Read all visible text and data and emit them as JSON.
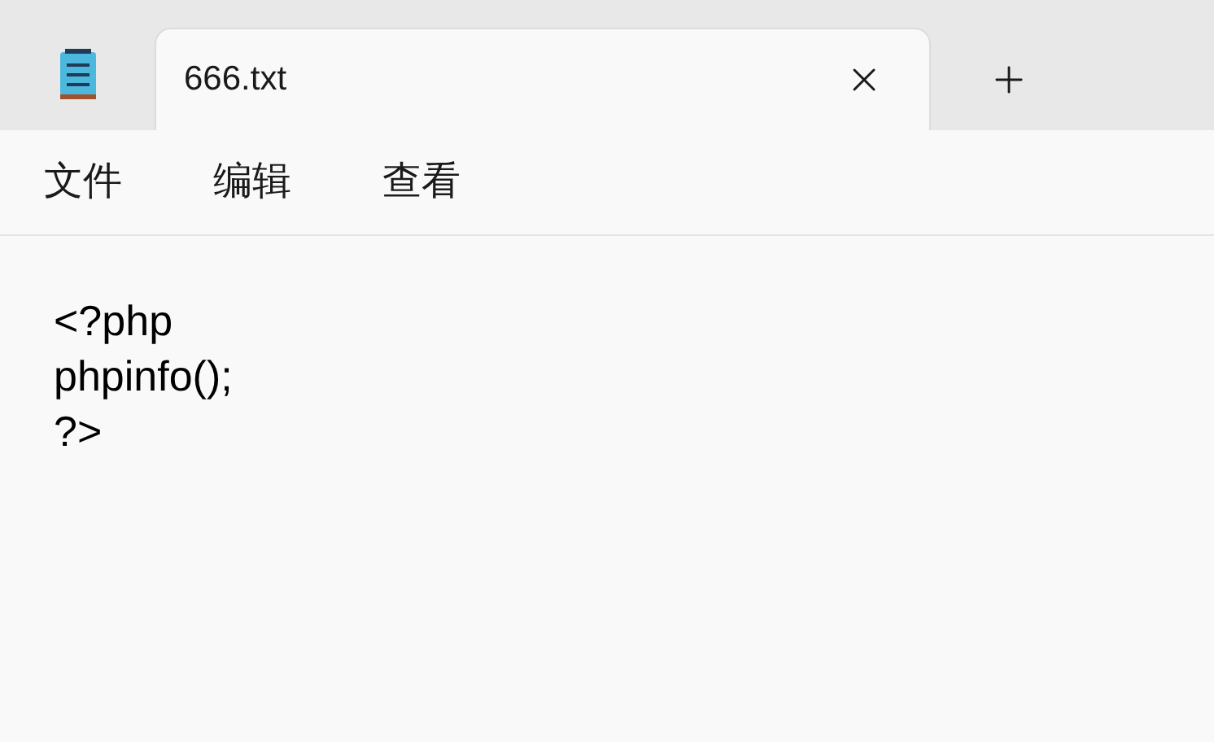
{
  "tabs": [
    {
      "label": "666.txt",
      "selected": true
    }
  ],
  "menu": [
    "文件",
    "编辑",
    "查看"
  ],
  "editor": {
    "lines": [
      "<?php",
      "phpinfo();",
      "?>"
    ]
  }
}
